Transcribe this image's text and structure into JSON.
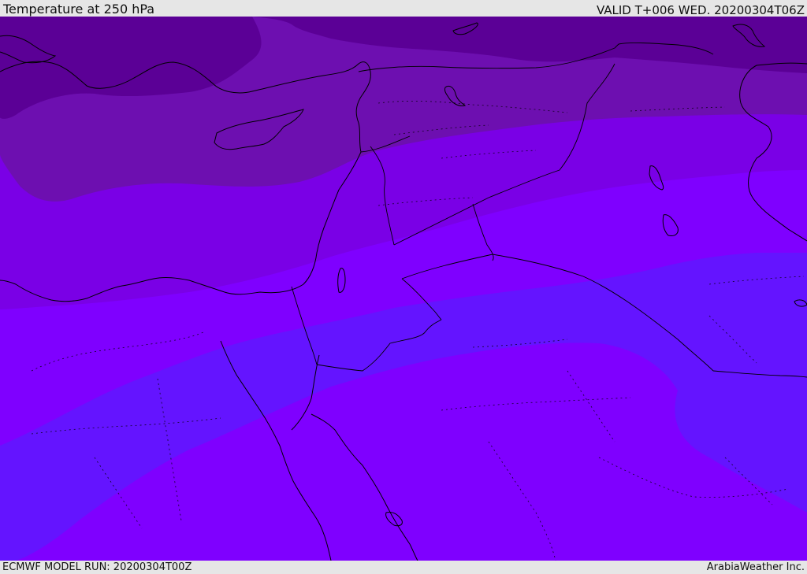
{
  "header": {
    "title": "Temperature at 250 hPa",
    "valid": "VALID T+006 WED. 20200304T06Z"
  },
  "footer": {
    "model_run": "ECMWF MODEL RUN: 20200304T00Z",
    "credit": "ArabiaWeather Inc."
  },
  "colors": {
    "band_coldest": "#5b0096",
    "band_cold": "#6d0fb0",
    "band_mid": "#7a00e6",
    "band_main": "#7f00ff",
    "band_warm": "#6414ff",
    "coastline": "#000000",
    "border": "#000000"
  }
}
